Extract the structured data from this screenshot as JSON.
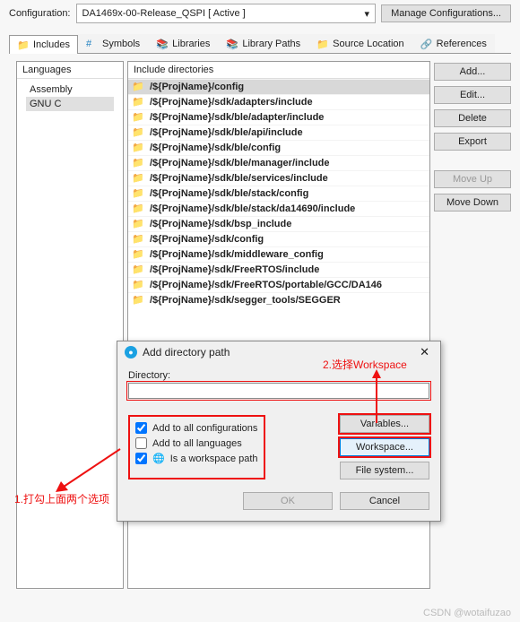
{
  "config": {
    "label": "Configuration:",
    "value": "DA1469x-00-Release_QSPI   [ Active ]",
    "manage_btn": "Manage Configurations..."
  },
  "tabs": [
    {
      "id": "includes",
      "label": "Includes",
      "active": true
    },
    {
      "id": "symbols",
      "label": "Symbols"
    },
    {
      "id": "libraries",
      "label": "Libraries"
    },
    {
      "id": "libpaths",
      "label": "Library Paths"
    },
    {
      "id": "srcloc",
      "label": "Source Location"
    },
    {
      "id": "refs",
      "label": "References"
    }
  ],
  "lang": {
    "header": "Languages",
    "items": [
      "Assembly",
      "GNU C"
    ],
    "selected": "GNU C"
  },
  "includes": {
    "header": "Include directories",
    "items": [
      "/${ProjName}/config",
      "/${ProjName}/sdk/adapters/include",
      "/${ProjName}/sdk/ble/adapter/include",
      "/${ProjName}/sdk/ble/api/include",
      "/${ProjName}/sdk/ble/config",
      "/${ProjName}/sdk/ble/manager/include",
      "/${ProjName}/sdk/ble/services/include",
      "/${ProjName}/sdk/ble/stack/config",
      "/${ProjName}/sdk/ble/stack/da14690/include",
      "/${ProjName}/sdk/bsp_include",
      "/${ProjName}/sdk/config",
      "/${ProjName}/sdk/middleware_config",
      "/${ProjName}/sdk/FreeRTOS/include",
      "/${ProjName}/sdk/FreeRTOS/portable/GCC/DA146",
      "/${ProjName}/sdk/segger_tools/SEGGER"
    ],
    "selected_index": 0
  },
  "side_buttons": {
    "add": "Add...",
    "edit": "Edit...",
    "delete": "Delete",
    "export": "Export",
    "moveup": "Move Up",
    "movedown": "Move Down"
  },
  "dialog": {
    "title": "Add directory path",
    "dir_label": "Directory:",
    "dir_value": "",
    "chk_all_config": "Add to all configurations",
    "chk_all_lang": "Add to all languages",
    "chk_workspace": "Is a workspace path",
    "btn_variables": "Variables...",
    "btn_workspace": "Workspace...",
    "btn_filesystem": "File system...",
    "btn_ok": "OK",
    "btn_cancel": "Cancel"
  },
  "annotations": {
    "a1": "1.打勾上面两个选项",
    "a2": "2.选择Workspace"
  },
  "watermark": "CSDN @wotaifuzao"
}
